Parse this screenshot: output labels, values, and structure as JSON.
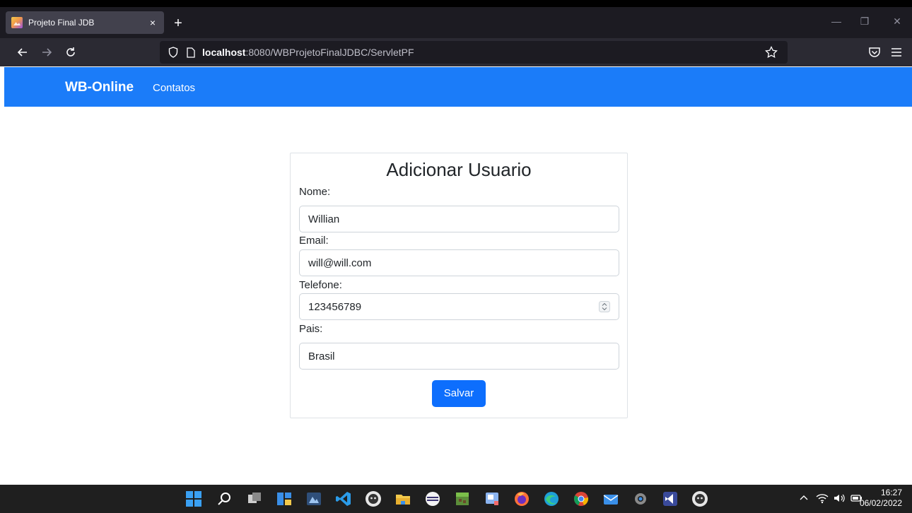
{
  "browser": {
    "tab_title": "Projeto Final JDB",
    "tab_close": "×",
    "new_tab": "+",
    "url_host": "localhost",
    "url_rest": ":8080/WBProjetoFinalJDBC/ServletPF",
    "window_controls": [
      "—",
      "❐",
      "✕"
    ]
  },
  "site": {
    "brand": "WB-Online",
    "nav_link": "Contatos"
  },
  "form": {
    "title": "Adicionar Usuario",
    "nome_label": "Nome:",
    "nome_value": "Willian",
    "email_label": "Email:",
    "email_value": "will@will.com",
    "telefone_label": "Telefone:",
    "telefone_value": "123456789",
    "pais_label": "Pais:",
    "pais_value": "Brasil",
    "submit_label": "Salvar"
  },
  "taskbar": {
    "time": "16:27",
    "date": "06/02/2022"
  },
  "colors": {
    "site_nav": "#1b7cf9",
    "button": "#0d6efd"
  }
}
